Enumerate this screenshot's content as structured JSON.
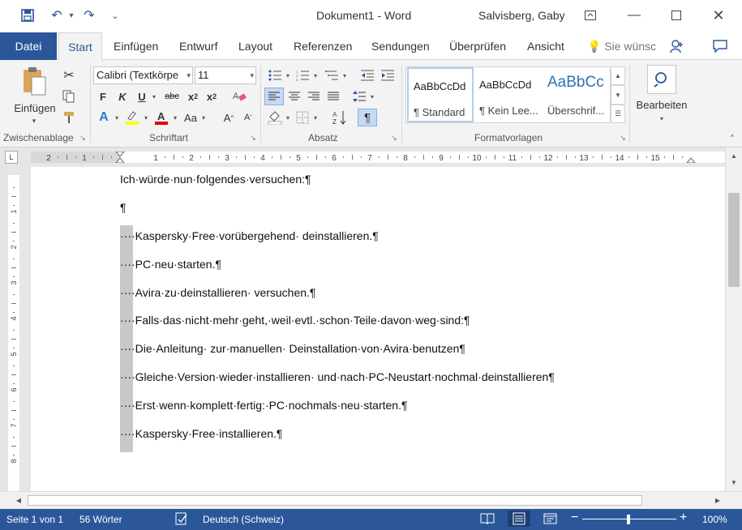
{
  "titlebar": {
    "title": "Dokument1  -  Word",
    "user": "Salvisberg, Gaby",
    "qat_more": "⌄"
  },
  "tabs": [
    "Datei",
    "Start",
    "Einfügen",
    "Entwurf",
    "Layout",
    "Referenzen",
    "Sendungen",
    "Überprüfen",
    "Ansicht"
  ],
  "tellme": "Sie wünsc",
  "ribbon": {
    "clipboard": {
      "paste_label": "Einfügen",
      "group": "Zwischenablage"
    },
    "font": {
      "name": "Calibri (Textkörpe",
      "size": "11",
      "group": "Schriftart",
      "case_label": "Aa"
    },
    "paragraph": {
      "group": "Absatz"
    },
    "styles": {
      "group": "Formatvorlagen",
      "items": [
        {
          "sample": "AaBbCcDd",
          "name": "¶ Standard"
        },
        {
          "sample": "AaBbCcDd",
          "name": "¶ Kein Lee..."
        },
        {
          "sample": "AaBbCc",
          "name": "Überschrif..."
        }
      ]
    },
    "editing": {
      "label": "Bearbeiten"
    }
  },
  "ruler": {
    "ticks": [
      "2",
      "1",
      "1",
      "2",
      "3",
      "4",
      "5",
      "6",
      "7",
      "8",
      "9",
      "10",
      "11",
      "12",
      "13",
      "14",
      "15"
    ]
  },
  "vruler": {
    "ticks": [
      "1",
      "2",
      "3",
      "4",
      "5",
      "6",
      "7",
      "8"
    ]
  },
  "document": {
    "lines": [
      "Ich·würde·nun·folgendes·versuchen:¶",
      "¶",
      "····Kaspersky·Free·vorübergehend· deinstallieren.¶",
      "····PC·neu·starten.¶",
      "····Avira·zu·deinstallieren· versuchen.¶",
      "····Falls·das·nicht·mehr·geht,·weil·evtl.·schon·Teile·davon·weg·sind:¶",
      "····Die·Anleitung· zur·manuellen· Deinstallation·von·Avira·benutzen¶",
      "····Gleiche·Version·wieder·installieren· und·nach·PC-Neustart·nochmal·deinstallieren¶",
      "····Erst·wenn·komplett·fertig:·PC·nochmals·neu·starten.¶",
      "····Kaspersky·Free·installieren.¶"
    ]
  },
  "status": {
    "page": "Seite 1 von 1",
    "words": "56 Wörter",
    "language": "Deutsch (Schweiz)",
    "zoom": "100%"
  },
  "colors": {
    "accent": "#2b579a",
    "ribbon_bg": "#f3f3f3"
  }
}
